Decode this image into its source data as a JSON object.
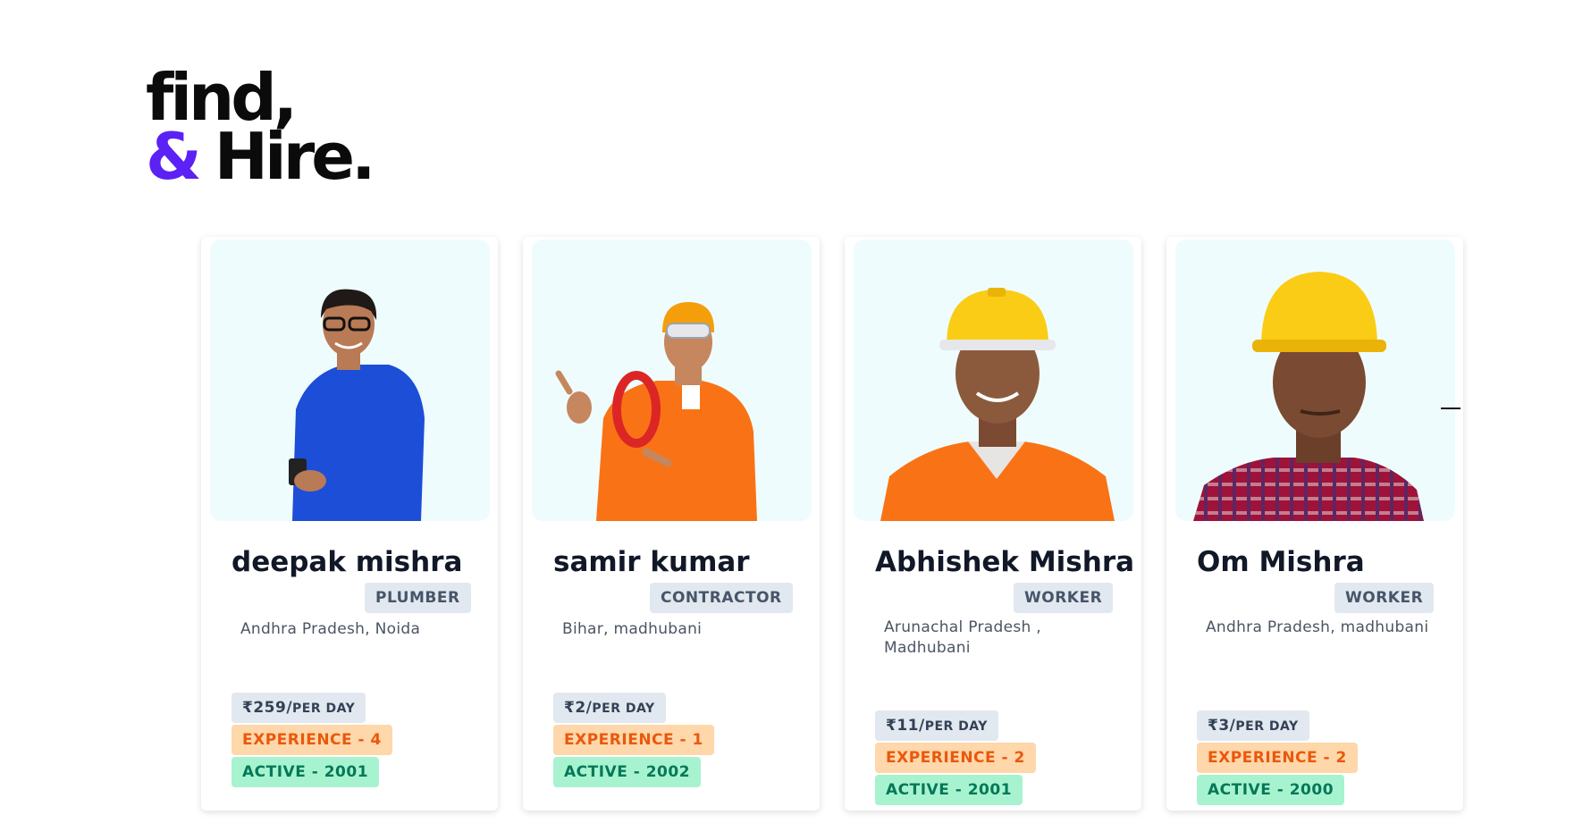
{
  "brand": {
    "line1": "find,",
    "amp": "&",
    "hire": "Hire."
  },
  "workers": [
    {
      "name": "deepak mishra",
      "role": "PLUMBER",
      "location": "Andhra Pradesh, Noida",
      "price": "₹259/",
      "per": "PER DAY",
      "experience": "EXPERIENCE - 4",
      "active": "ACTIVE - 2001"
    },
    {
      "name": "samir kumar",
      "role": "CONTRACTOR",
      "location": "Bihar, madhubani",
      "price": "₹2/",
      "per": "PER DAY",
      "experience": "EXPERIENCE - 1",
      "active": "ACTIVE - 2002"
    },
    {
      "name": "Abhishek Mishra",
      "role": "WORKER",
      "location": "Arunachal Pradesh , Madhubani",
      "price": "₹11/",
      "per": "PER DAY",
      "experience": "EXPERIENCE - 2",
      "active": "ACTIVE - 2001"
    },
    {
      "name": "Om Mishra",
      "role": "WORKER",
      "location": "Andhra Pradesh, madhubani",
      "price": "₹3/",
      "per": "PER DAY",
      "experience": "EXPERIENCE - 2",
      "active": "ACTIVE - 2000"
    }
  ],
  "colors": {
    "accent": "#5b21f5",
    "photo_bg": "#effcfd",
    "experience": "#ea580c",
    "active": "#047857"
  }
}
